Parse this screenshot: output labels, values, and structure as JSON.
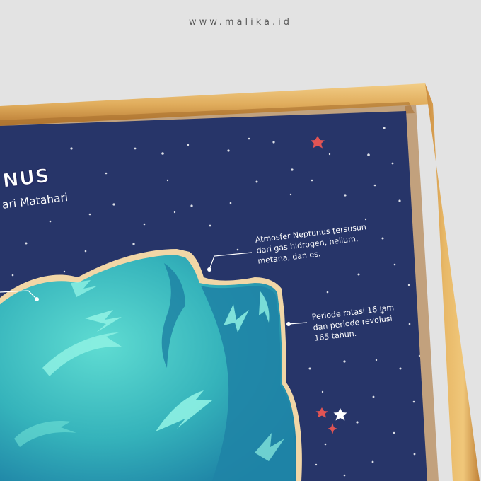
{
  "site_url": "www.malika.id",
  "poster": {
    "title": "NUS",
    "subtitle": "ari Matahari",
    "facts": [
      {
        "lines": [
          "Atmosfer Neptunus tersusun",
          "dari gas hidrogen, helium,",
          "metana, dan es."
        ]
      },
      {
        "lines": [
          "Periode rotasi 16 jam",
          "dan periode revolusi",
          "165 tahun."
        ]
      }
    ]
  },
  "colors": {
    "background": "#e3e3e3",
    "frame_wood": "#e2b15e",
    "poster_navy": "#273569",
    "planet_teal": "#2fa3b3",
    "planet_light": "#58dcd2",
    "star_red": "#e05454"
  }
}
